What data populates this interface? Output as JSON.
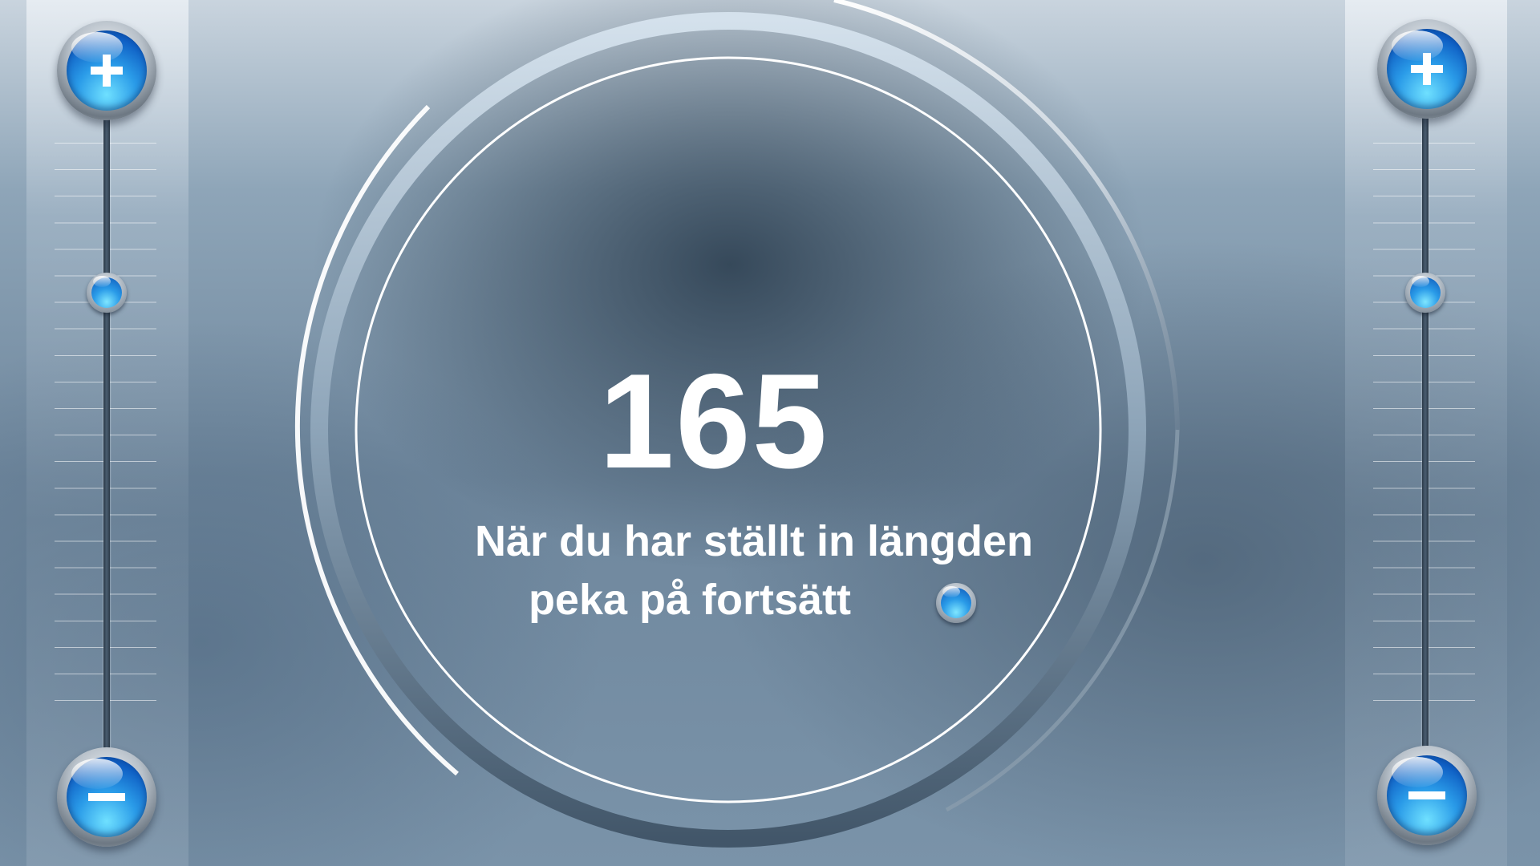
{
  "display": {
    "value": "165",
    "instruction_line_1": "När du har ställt in längden",
    "instruction_line_2": "peka på fortsätt"
  },
  "left_slider": {
    "increase_icon": "plus-icon",
    "decrease_icon": "minus-icon",
    "level": 0.27
  },
  "right_slider": {
    "increase_icon": "plus-icon",
    "decrease_icon": "minus-icon",
    "level": 0.27
  },
  "continue": {
    "icon": "blue-dot-icon"
  },
  "colors": {
    "accent_blue": "#1f7fe0",
    "text": "#ffffff",
    "track": "#3a4b5c"
  }
}
